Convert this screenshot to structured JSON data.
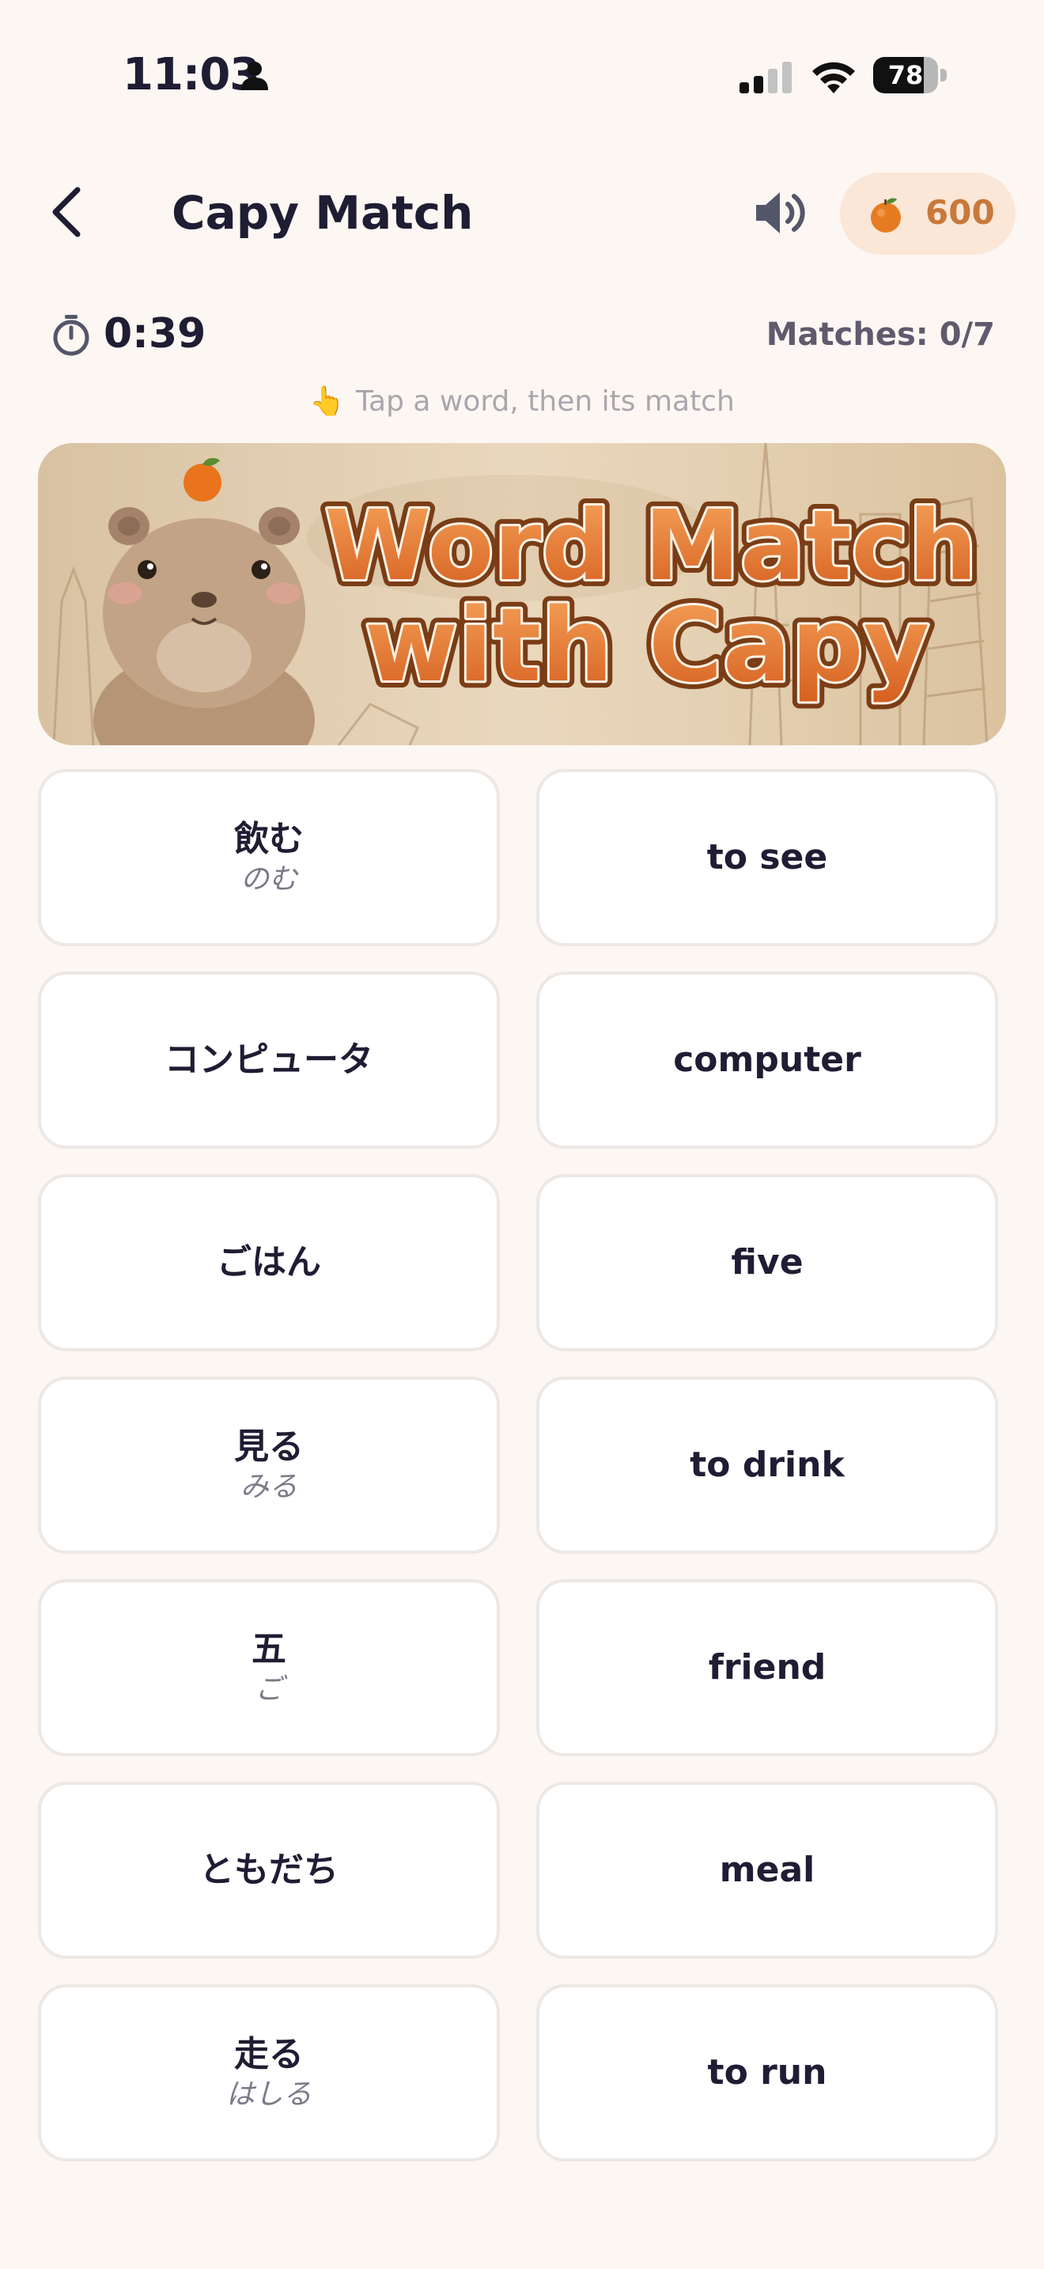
{
  "status_bar": {
    "time": "11:03",
    "battery": "78",
    "battery_level": 0.78
  },
  "header": {
    "title": "Capy Match",
    "coins": "600"
  },
  "game": {
    "timer": "0:39",
    "matches": "Matches: 0/7",
    "hint": "Tap a word, then its match"
  },
  "banner": {
    "line1": "Word Match",
    "line2": "with Capy"
  },
  "left_cards": [
    {
      "word": "飲む",
      "reading": "のむ"
    },
    {
      "word": "コンピュータ",
      "reading": ""
    },
    {
      "word": "ごはん",
      "reading": ""
    },
    {
      "word": "見る",
      "reading": "みる"
    },
    {
      "word": "五",
      "reading": "ご"
    },
    {
      "word": "ともだち",
      "reading": ""
    },
    {
      "word": "走る",
      "reading": "はしる"
    }
  ],
  "right_cards": [
    {
      "word": "to see"
    },
    {
      "word": "computer"
    },
    {
      "word": "five"
    },
    {
      "word": "to drink"
    },
    {
      "word": "friend"
    },
    {
      "word": "meal"
    },
    {
      "word": "to run"
    }
  ],
  "colors": {
    "background": "#fdf7f3",
    "accent": "#c8793b",
    "coin_pill": "#fae7d8",
    "text_dark": "#1f1d33",
    "card_border": "#ece8e5"
  }
}
